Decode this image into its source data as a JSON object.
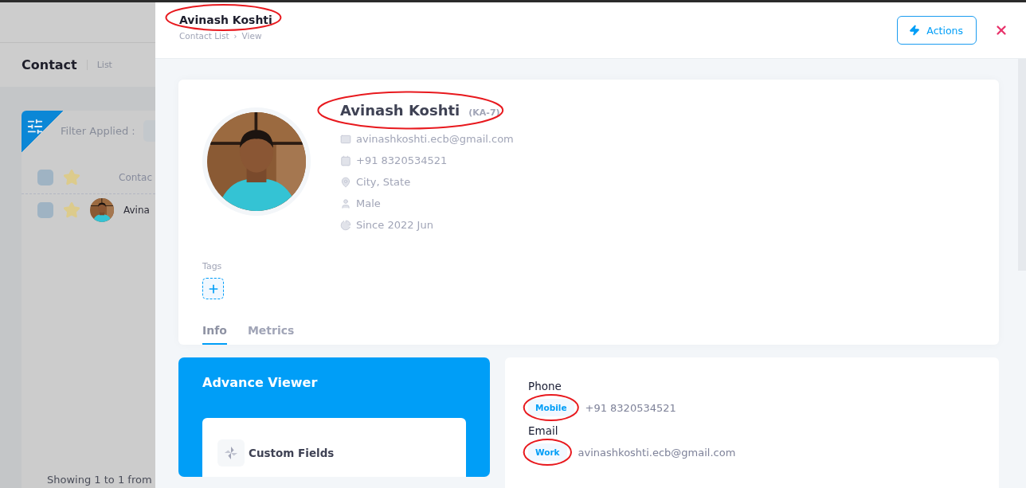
{
  "backdrop": {
    "page_title": "Contact",
    "page_subtitle": "List",
    "filter_label": "Filter Applied :",
    "header": {
      "checked": false,
      "starred": true,
      "column": "Contac"
    },
    "rows": [
      {
        "name": "Avina",
        "checked": false,
        "starred": true
      }
    ],
    "footer": "Showing 1 to 1 from"
  },
  "drawer": {
    "title": "Avinash Koshti",
    "title_circled": true,
    "breadcrumb": [
      "Contact List",
      "View"
    ],
    "breadcrumb_separator": "›",
    "actions_label": "Actions"
  },
  "profile": {
    "name": "Avinash Koshti",
    "code": "(KA-7)",
    "name_circled": true,
    "details": [
      {
        "kind": "email",
        "text": "avinashkoshti.ecb@gmail.com"
      },
      {
        "kind": "phone",
        "text": "+91 8320534521"
      },
      {
        "kind": "location",
        "text": "City, State"
      },
      {
        "kind": "gender",
        "text": "Male"
      },
      {
        "kind": "since",
        "text": "Since 2022 Jun"
      }
    ],
    "tags_label": "Tags"
  },
  "tabs": [
    {
      "label": "Info",
      "selected": true
    },
    {
      "label": "Metrics",
      "selected": false
    }
  ],
  "advance_viewer": {
    "title": "Advance Viewer",
    "items": [
      {
        "label": "Custom Fields"
      }
    ]
  },
  "info": {
    "sections": [
      {
        "label": "Phone",
        "entries": [
          {
            "type": "Mobile",
            "value": "+91 8320534521",
            "circled": true
          }
        ]
      },
      {
        "label": "Email",
        "entries": [
          {
            "type": "Work",
            "value": "avinashkoshti.ecb@gmail.com",
            "circled": true
          }
        ]
      }
    ]
  }
}
